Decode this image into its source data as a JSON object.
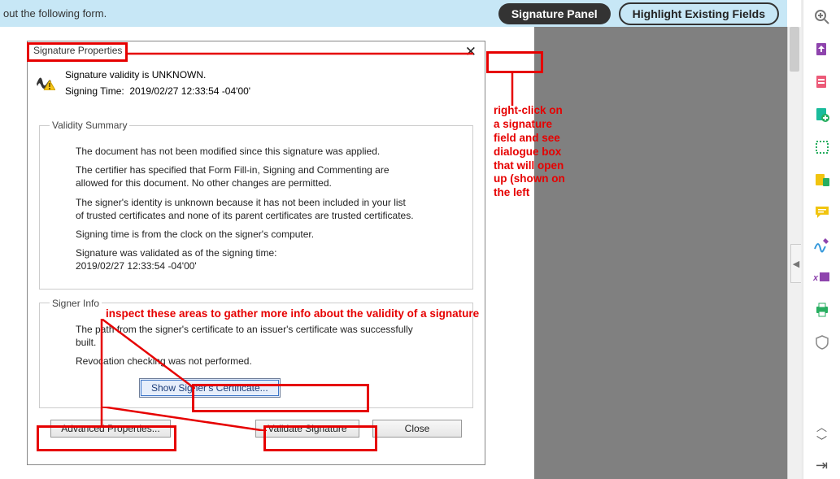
{
  "topbar": {
    "hint": "out the following form.",
    "signature_panel": "Signature Panel",
    "highlight_fields": "Highlight Existing Fields"
  },
  "dialog": {
    "title": "Signature Properties",
    "validity_line": "Signature validity is UNKNOWN.",
    "signing_time_label": "Signing Time:",
    "signing_time_value": "2019/02/27 12:33:54 -04'00'",
    "validity_legend": "Validity Summary",
    "v1": "The document has not been modified since this signature was applied.",
    "v2": "The certifier has specified that Form Fill-in, Signing and Commenting are allowed for this document. No other changes are permitted.",
    "v3": "The signer's identity is unknown because it has not been included in your list of trusted certificates and none of its parent certificates are trusted certificates.",
    "v4": "Signing time is from the clock on the signer's computer.",
    "v5a": "Signature was validated as of the signing time:",
    "v5b": "2019/02/27 12:33:54 -04'00'",
    "signer_legend": "Signer Info",
    "s1": "The path from the signer's certificate to an issuer's certificate was successfully built.",
    "s2": "Revocation checking was not performed.",
    "show_cert": "Show Signer's Certificate...",
    "adv_props": "Advanced Properties...",
    "validate_sig": "Validate Signature",
    "close": "Close"
  },
  "annotations": {
    "rc1": "right-click on a signature field and see dialogue box that will open up (shown on the left",
    "inspect": "inspect these areas to gather more info about the validity of a signature"
  },
  "right_tools": {
    "t1": "search-icon",
    "t2": "export-pdf-icon",
    "t3": "create-pdf-icon",
    "t4": "edit-pdf-icon",
    "t5": "combine-icon",
    "t6": "organize-icon",
    "t7": "comment-icon",
    "t8": "fill-sign-icon",
    "t9": "redact-icon",
    "t10": "print-icon",
    "t11": "protect-icon"
  }
}
